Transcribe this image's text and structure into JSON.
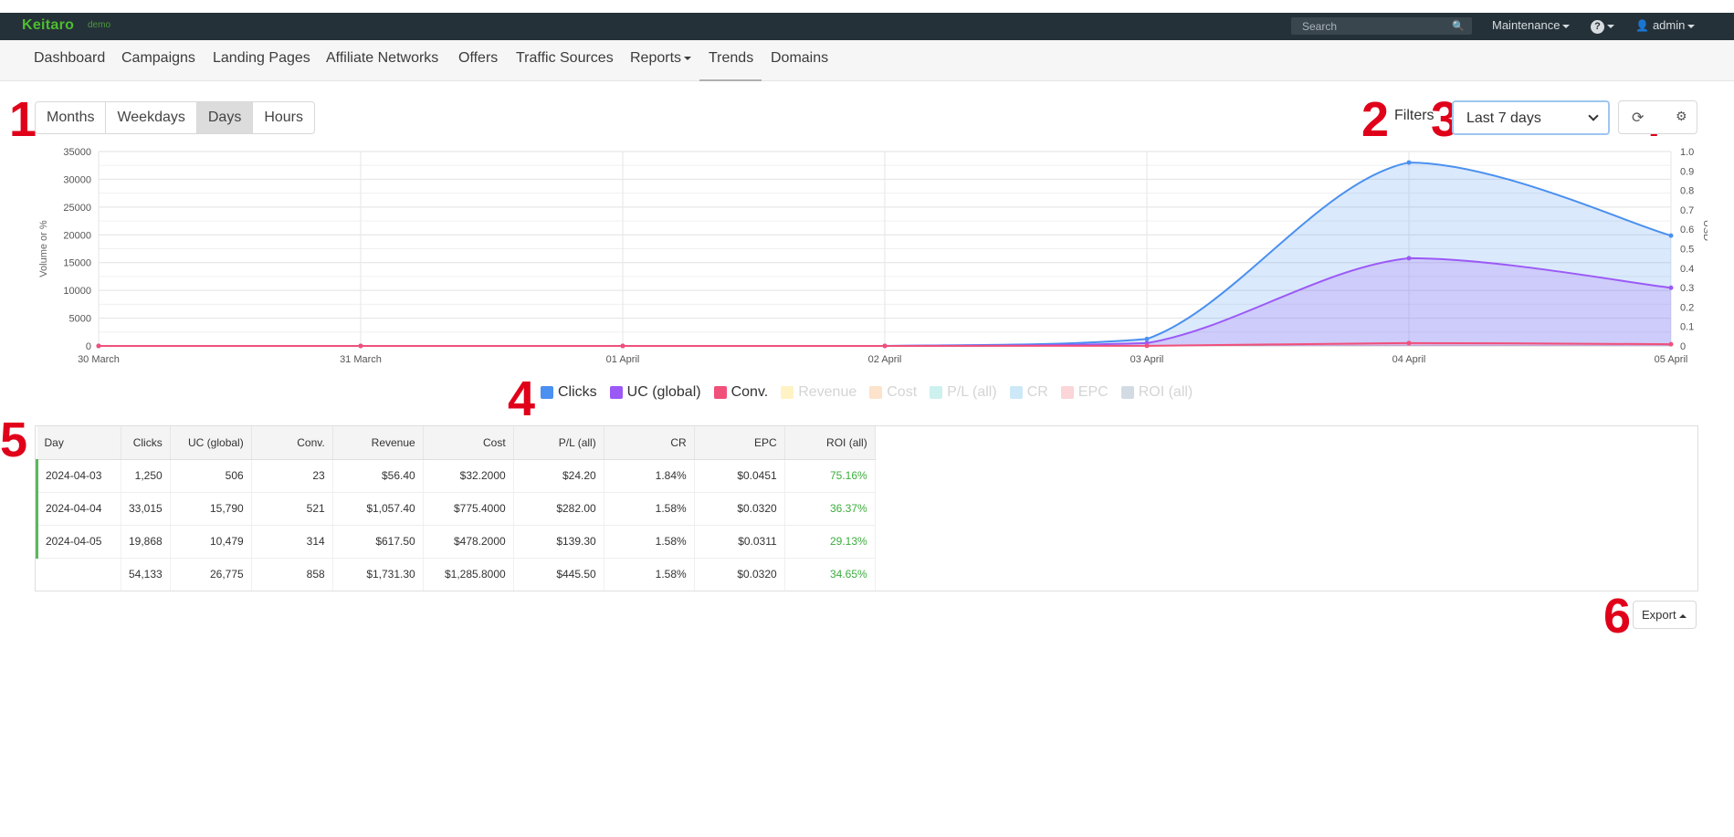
{
  "app": {
    "logo": "Keitaro",
    "logo_tag": "demo",
    "search_placeholder": "Search",
    "maintenance_label": "Maintenance",
    "help_label": "?",
    "user_label": "admin"
  },
  "nav": {
    "items": [
      "Dashboard",
      "Campaigns",
      "Landing Pages",
      "Affiliate Networks",
      "Offers",
      "Traffic Sources",
      "Reports",
      "Trends",
      "Domains"
    ],
    "active": "Trends"
  },
  "annotations": [
    "1",
    "2",
    "3",
    "4",
    "4",
    "5",
    "6"
  ],
  "toolbar": {
    "periods": [
      "Months",
      "Weekdays",
      "Days",
      "Hours"
    ],
    "active_period": "Days",
    "filters_label": "Filters",
    "date_range": "Last 7 days",
    "refresh_icon": "refresh-icon",
    "settings_icon": "settings-icon"
  },
  "chart_data": {
    "type": "area",
    "x": [
      "30 March",
      "31 March",
      "01 April",
      "02 April",
      "03 April",
      "04 April",
      "05 April"
    ],
    "ylabel": "Volume or %",
    "y2label": "USD",
    "ylim": [
      0,
      35000
    ],
    "yticks": [
      0,
      5000,
      10000,
      15000,
      20000,
      25000,
      30000,
      35000
    ],
    "y2lim": [
      0,
      1.0
    ],
    "y2ticks": [
      "0",
      "0.1",
      "0.2",
      "0.3",
      "0.4",
      "0.5",
      "0.6",
      "0.7",
      "0.8",
      "0.9",
      "1.0"
    ],
    "grid": true,
    "series": [
      {
        "name": "Clicks",
        "color": "#4a90f0",
        "values": [
          0,
          0,
          0,
          0,
          1250,
          33015,
          19868
        ],
        "visible": true
      },
      {
        "name": "UC (global)",
        "color": "#9b59f6",
        "values": [
          0,
          0,
          0,
          0,
          506,
          15790,
          10479
        ],
        "visible": true
      },
      {
        "name": "Conv.",
        "color": "#f0507a",
        "values": [
          0,
          0,
          0,
          0,
          23,
          521,
          314
        ],
        "visible": true
      }
    ]
  },
  "legend": [
    {
      "name": "Clicks",
      "color": "#4a90f0",
      "enabled": true
    },
    {
      "name": "UC (global)",
      "color": "#9b59f6",
      "enabled": true
    },
    {
      "name": "Conv.",
      "color": "#f0507a",
      "enabled": true
    },
    {
      "name": "Revenue",
      "color": "#fff2c4",
      "enabled": false
    },
    {
      "name": "Cost",
      "color": "#fde2cc",
      "enabled": false
    },
    {
      "name": "P/L (all)",
      "color": "#cdf1ef",
      "enabled": false
    },
    {
      "name": "CR",
      "color": "#cde9f8",
      "enabled": false
    },
    {
      "name": "EPC",
      "color": "#fbd5d8",
      "enabled": false
    },
    {
      "name": "ROI (all)",
      "color": "#d2dbe4",
      "enabled": false
    }
  ],
  "table": {
    "columns": [
      "Day",
      "Clicks",
      "UC (global)",
      "Conv.",
      "Revenue",
      "Cost",
      "P/L (all)",
      "CR",
      "EPC",
      "ROI (all)"
    ],
    "rows": [
      [
        "2024-04-03",
        "1,250",
        "506",
        "23",
        "$56.40",
        "$32.2000",
        "$24.20",
        "1.84%",
        "$0.0451",
        "75.16%"
      ],
      [
        "2024-04-04",
        "33,015",
        "15,790",
        "521",
        "$1,057.40",
        "$775.4000",
        "$282.00",
        "1.58%",
        "$0.0320",
        "36.37%"
      ],
      [
        "2024-04-05",
        "19,868",
        "10,479",
        "314",
        "$617.50",
        "$478.2000",
        "$139.30",
        "1.58%",
        "$0.0311",
        "29.13%"
      ]
    ],
    "total": [
      "",
      "54,133",
      "26,775",
      "858",
      "$1,731.30",
      "$1,285.8000",
      "$445.50",
      "1.58%",
      "$0.0320",
      "34.65%"
    ]
  },
  "export_label": "Export"
}
